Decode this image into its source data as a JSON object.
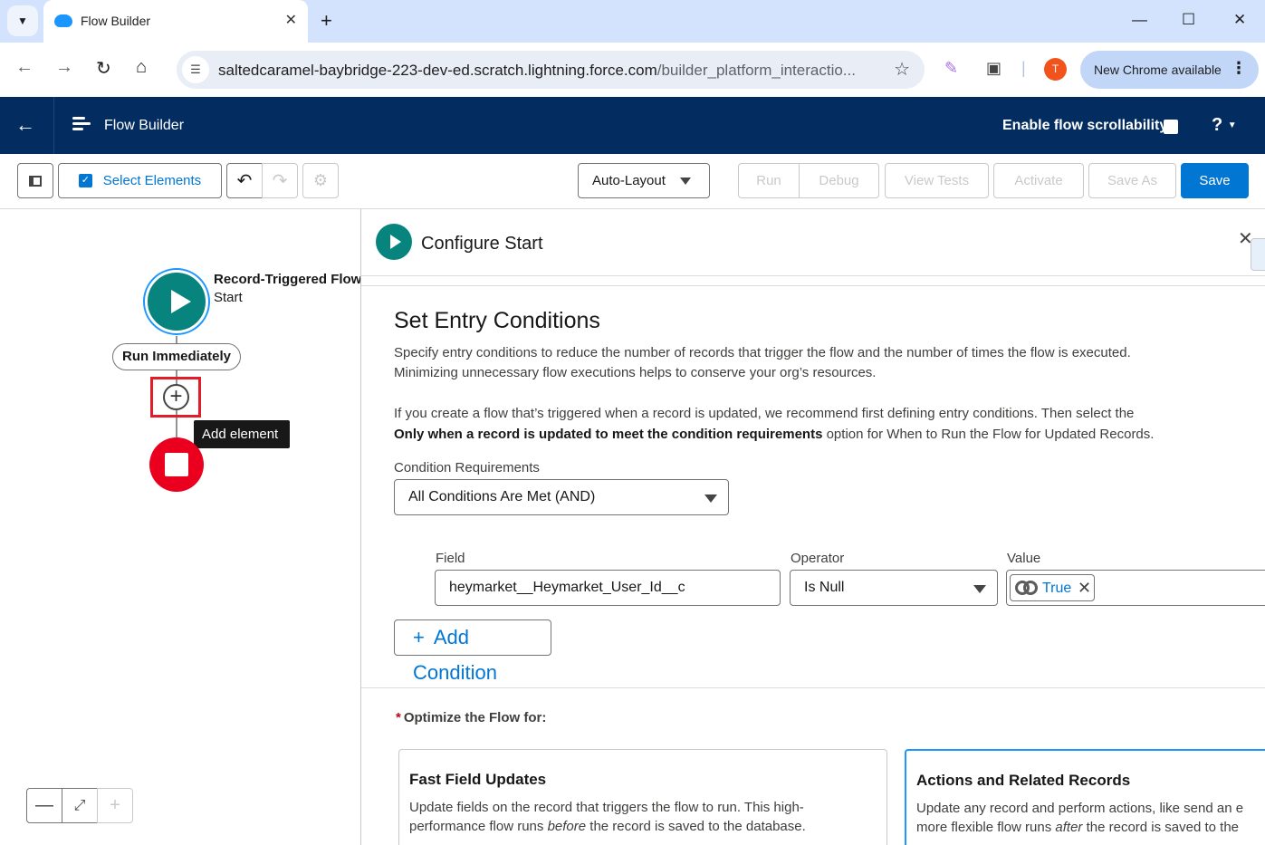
{
  "browser": {
    "tab_title": "Flow Builder",
    "url_host": "saltedcaramel-baybridge-223-dev-ed.scratch.lightning.force.com",
    "url_path": "/builder_platform_interactio...",
    "profile_initial": "T",
    "update_label": "New Chrome available"
  },
  "header": {
    "title": "Flow Builder",
    "scroll_label": "Enable flow scrollability",
    "help_label": "?"
  },
  "toolbar": {
    "select_elements": "Select Elements",
    "layout_value": "Auto-Layout",
    "run": "Run",
    "debug": "Debug",
    "view_tests": "View Tests",
    "activate": "Activate",
    "save_as": "Save As",
    "save": "Save"
  },
  "canvas": {
    "start_title": "Record-Triggered Flow",
    "start_sub": "Start",
    "run_pill": "Run Immediately",
    "tooltip": "Add element"
  },
  "panel": {
    "title": "Configure Start",
    "section_title": "Set Entry Conditions",
    "desc1": "Specify entry conditions to reduce the number of records that trigger the flow and the number of times the flow is executed.",
    "desc2": "Minimizing unnecessary flow executions helps to conserve your org’s resources.",
    "desc3": "If you create a flow that’s triggered when a record is updated, we recommend first defining entry conditions. Then select the",
    "desc4_bold": "Only when a record is updated to meet the condition requirements",
    "desc4_rest": " option for When to Run the Flow for Updated Records.",
    "cond_req_label": "Condition Requirements",
    "cond_req_value": "All Conditions Are Met (AND)",
    "field_label": "Field",
    "field_value": "heymarket__Heymarket_User_Id__c",
    "operator_label": "Operator",
    "operator_value": "Is Null",
    "value_label": "Value",
    "value_value": "True",
    "add_condition": "Add Condition",
    "optimize_label": "Optimize the Flow for:",
    "card1_title": "Fast Field Updates",
    "card1_line1": "Update fields on the record that triggers the flow to run. This high-",
    "card1_line2_a": "performance flow runs ",
    "card1_line2_em": "before",
    "card1_line2_b": " the record is saved to the database.",
    "card2_title": "Actions and Related Records",
    "card2_line1": "Update any record and perform actions, like send an e",
    "card2_line2_a": "more flexible flow runs ",
    "card2_line2_em": "after",
    "card2_line2_b": " the record is saved to the"
  },
  "icons": [
    "chevron-down-icon",
    "salesforce-cloud-icon",
    "close-icon",
    "plus-icon",
    "back-icon",
    "forward-icon",
    "reload-icon",
    "home-icon",
    "site-info-icon",
    "star-icon",
    "pen-icon",
    "extensions-icon",
    "flow-icon",
    "panel-toggle-icon",
    "undo-icon",
    "redo-icon",
    "gear-icon",
    "zoom-out-icon",
    "fit-icon",
    "zoom-in-icon"
  ],
  "colors": {
    "header_bg": "#032d60",
    "brand_blue": "#0176d3",
    "start_green": "#06847d",
    "end_red": "#ea001e"
  }
}
